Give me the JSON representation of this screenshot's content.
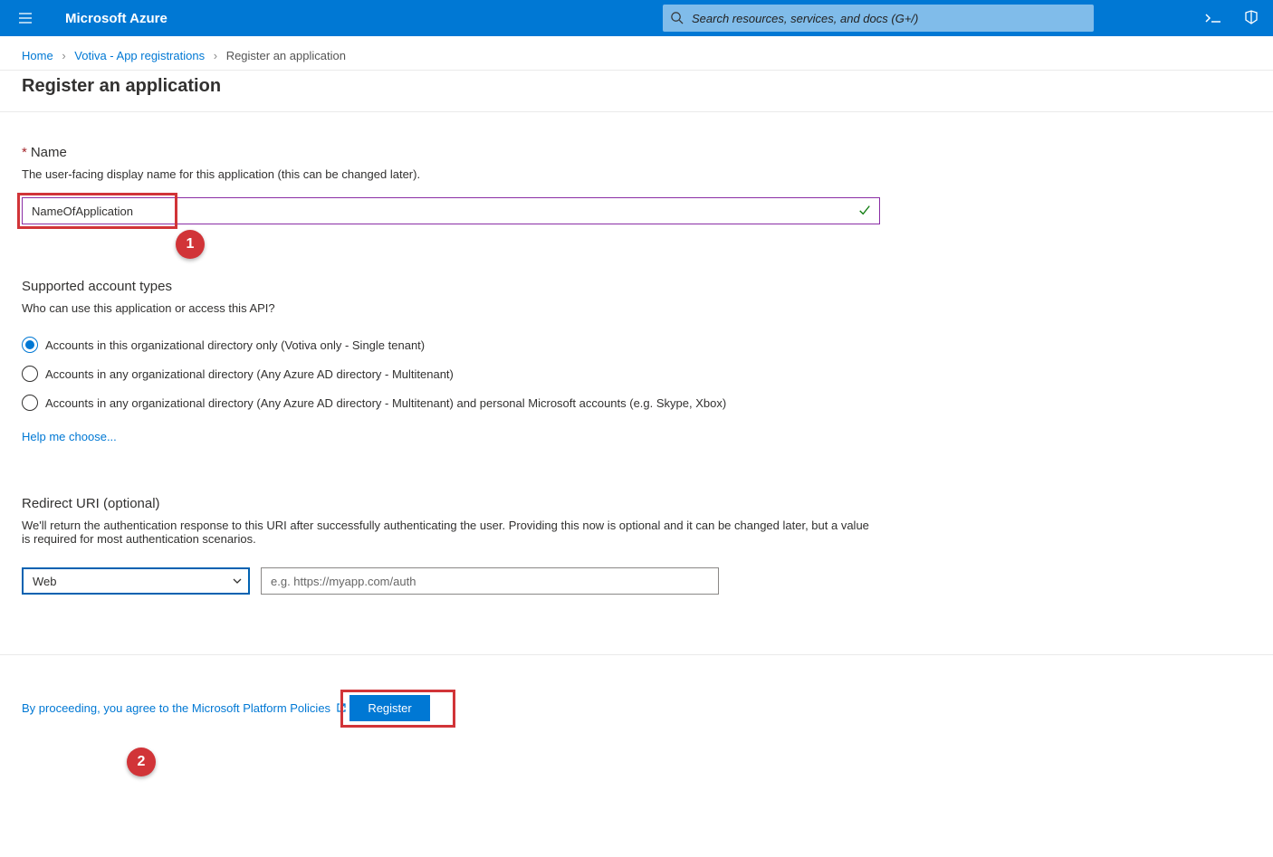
{
  "topbar": {
    "brand": "Microsoft Azure",
    "search_placeholder": "Search resources, services, and docs (G+/)"
  },
  "breadcrumb": {
    "home": "Home",
    "mid": "Votiva - App registrations",
    "current": "Register an application"
  },
  "page_title": "Register an application",
  "name_section": {
    "label": "Name",
    "desc": "The user-facing display name for this application (this can be changed later).",
    "value": "NameOfApplication"
  },
  "account_section": {
    "title": "Supported account types",
    "desc": "Who can use this application or access this API?",
    "options": [
      "Accounts in this organizational directory only (Votiva only - Single tenant)",
      "Accounts in any organizational directory (Any Azure AD directory - Multitenant)",
      "Accounts in any organizational directory (Any Azure AD directory - Multitenant) and personal Microsoft accounts (e.g. Skype, Xbox)"
    ],
    "help_link": "Help me choose..."
  },
  "redirect_section": {
    "title": "Redirect URI (optional)",
    "desc": "We'll return the authentication response to this URI after successfully authenticating the user. Providing this now is optional and it can be changed later, but a value is required for most authentication scenarios.",
    "select_value": "Web",
    "uri_placeholder": "e.g. https://myapp.com/auth"
  },
  "footer": {
    "policy_text": "By proceeding, you agree to the Microsoft Platform Policies",
    "register_label": "Register"
  },
  "callouts": {
    "one": "1",
    "two": "2"
  }
}
